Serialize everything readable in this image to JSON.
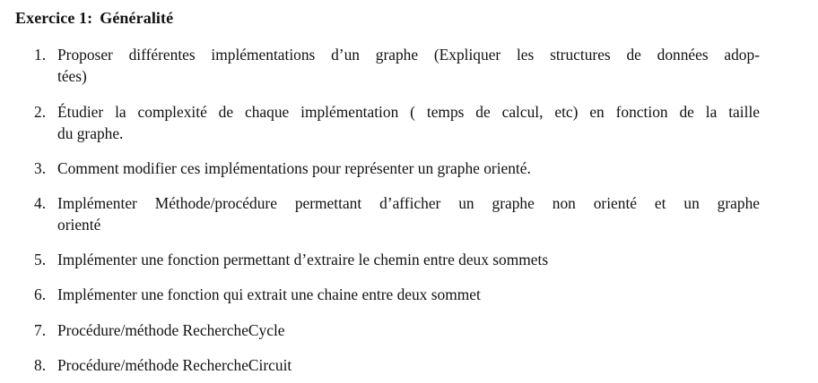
{
  "exercise": {
    "number": "Exercice 1:",
    "title": "Généralité"
  },
  "items": [
    {
      "marker": "1.",
      "line1": "Proposer différentes implémentations d’un graphe (Expliquer les structures de données adop-",
      "line2": "tées)"
    },
    {
      "marker": "2.",
      "line1": "Étudier la complexité de chaque implémentation ( temps de calcul, etc) en fonction de la taille",
      "line2": "du graphe."
    },
    {
      "marker": "3.",
      "line1": "Comment modifier ces implémentations pour représenter un graphe orienté.",
      "line2": ""
    },
    {
      "marker": "4.",
      "line1": "Implémenter Méthode/procédure permettant d’afficher un graphe non orienté et un graphe",
      "line2": "orienté"
    },
    {
      "marker": "5.",
      "line1": "Implémenter une fonction permettant d’extraire le chemin entre deux sommets",
      "line2": ""
    },
    {
      "marker": "6.",
      "line1": "Implémenter une fonction qui extrait une chaine entre deux sommet",
      "line2": ""
    },
    {
      "marker": "7.",
      "line1": "Procédure/méthode RechercheCycle",
      "line2": ""
    },
    {
      "marker": "8.",
      "line1": "Procédure/méthode RechercheCircuit",
      "line2": ""
    }
  ]
}
